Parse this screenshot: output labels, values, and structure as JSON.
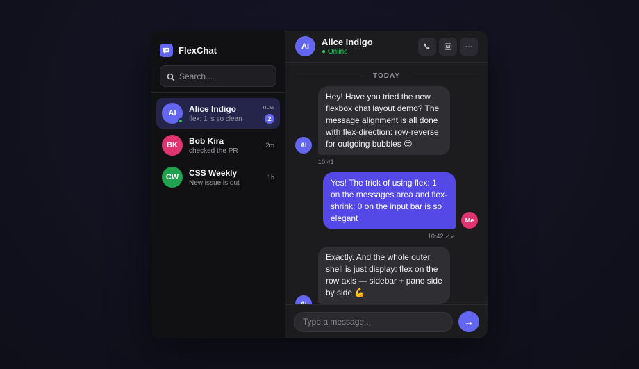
{
  "app": {
    "name": "FlexChat",
    "logo_icon": "chat-bubble-icon",
    "accent": "#6366f1"
  },
  "search": {
    "placeholder": "Search...",
    "value": ""
  },
  "conversations": [
    {
      "initials": "AI",
      "name": "Alice Indigo",
      "preview": "flex: 1 is so clean",
      "time": "now",
      "unread": "2",
      "color": "#6366f1",
      "online": true,
      "active": true
    },
    {
      "initials": "BK",
      "name": "Bob Kira",
      "preview": "checked the PR",
      "time": "2m",
      "color": "#e0336f"
    },
    {
      "initials": "CW",
      "name": "CSS Weekly",
      "preview": "New issue is out",
      "time": "1h",
      "color": "#1fa34f"
    }
  ],
  "header": {
    "initials": "AI",
    "name": "Alice Indigo",
    "status": "● Online",
    "buttons": [
      "phone-icon",
      "video-icon",
      "more-icon"
    ],
    "more_label": "···"
  },
  "day_separator": "TODAY",
  "messages": [
    {
      "side": "in",
      "initials": "AI",
      "text": "Hey! Have you tried the new flexbox chat layout demo? The message alignment is all done with flex-direction: row-reverse for outgoing bubbles 😍",
      "time": "10:41"
    },
    {
      "side": "out",
      "initials": "Me",
      "text": "Yes! The trick of using flex: 1 on the messages area and flex-shrink: 0 on the input bar is so elegant",
      "time": "10:42 ✓✓"
    },
    {
      "side": "in",
      "initials": "AI",
      "text": "Exactly. And the whole outer shell is just display: flex on the row axis — sidebar + pane side by side 💪",
      "time": ""
    }
  ],
  "composer": {
    "placeholder": "Type a message...",
    "value": "",
    "send_label": "→"
  },
  "colors": {
    "me_avatar": "#e0336f",
    "online": "#22c55e",
    "outgoing_bubble": "#5448e6"
  }
}
